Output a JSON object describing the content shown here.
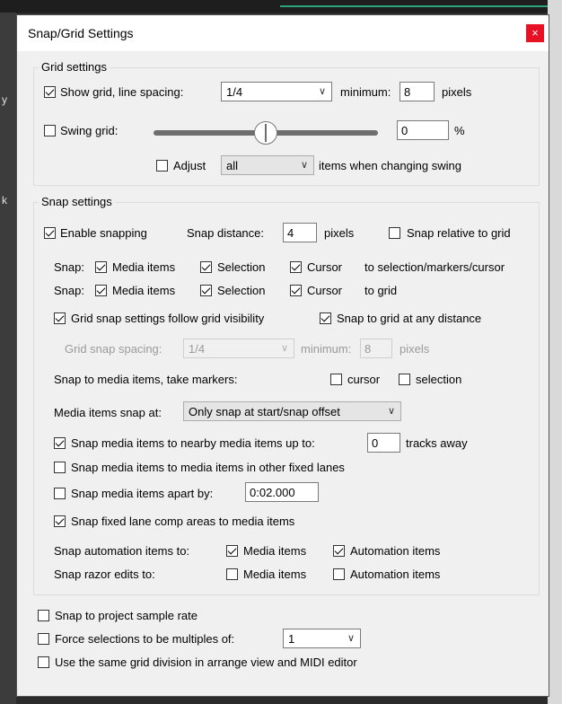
{
  "dialog": {
    "title": "Snap/Grid Settings",
    "close_label": "×"
  },
  "background": {
    "side_text": [
      "y",
      "k"
    ]
  },
  "grid": {
    "legend": "Grid settings",
    "show_grid": {
      "label": "Show grid, line spacing:",
      "checked": true,
      "value": "1/4",
      "minimum_label": "minimum:",
      "minimum": "8",
      "unit": "pixels"
    },
    "swing": {
      "label": "Swing grid:",
      "checked": false,
      "value": "0",
      "unit": "%",
      "slider_level": 0.5
    },
    "adjust": {
      "label": "Adjust",
      "checked": false,
      "value": "all",
      "suffix": "items when changing swing"
    }
  },
  "snap": {
    "legend": "Snap settings",
    "enable": {
      "label": "Enable snapping",
      "checked": true
    },
    "distance_label": "Snap distance:",
    "distance": "4",
    "distance_unit": "pixels",
    "relative": {
      "label": "Snap relative to grid",
      "checked": false
    },
    "row1": {
      "prefix": "Snap:",
      "media": "Media items",
      "selection": "Selection",
      "cursor": "Cursor",
      "suffix": "to selection/markers/cursor"
    },
    "row2": {
      "prefix": "Snap:",
      "media": "Media items",
      "selection": "Selection",
      "cursor": "Cursor",
      "suffix": "to grid"
    },
    "follow": {
      "label": "Grid snap settings follow grid visibility",
      "checked": true
    },
    "any_distance": {
      "label": "Snap to grid at any distance",
      "checked": true
    },
    "spacing_label": "Grid snap spacing:",
    "spacing": "1/4",
    "spacing_min_label": "minimum:",
    "spacing_min": "8",
    "spacing_unit": "pixels",
    "take_markers_label": "Snap to media items, take markers:",
    "cursor_label": "cursor",
    "selection_label": "selection",
    "media_snap_at_label": "Media items snap at:",
    "media_snap_at": "Only snap at start/snap offset",
    "nearby": {
      "label": "Snap media items to nearby media items up to:",
      "value": "0",
      "suffix": "tracks away",
      "checked": true
    },
    "fixed_lanes": {
      "label": "Snap media items to media items in other fixed lanes",
      "checked": false
    },
    "apart": {
      "label": "Snap media items apart by:",
      "value": "0:02.000",
      "checked": false
    },
    "comp": {
      "label": "Snap fixed lane comp areas to media items",
      "checked": true
    },
    "automation_label": "Snap automation items to:",
    "razor_label": "Snap razor edits to:",
    "media_items_label": "Media items",
    "automation_items_label": "Automation items"
  },
  "bottom": {
    "sample_rate": {
      "label": "Snap to project sample rate",
      "checked": false
    },
    "multiples": {
      "label": "Force selections to be multiples of:",
      "value": "1",
      "checked": false
    },
    "same_grid": {
      "label": "Use the same grid division in arrange view and MIDI editor",
      "checked": false
    }
  }
}
